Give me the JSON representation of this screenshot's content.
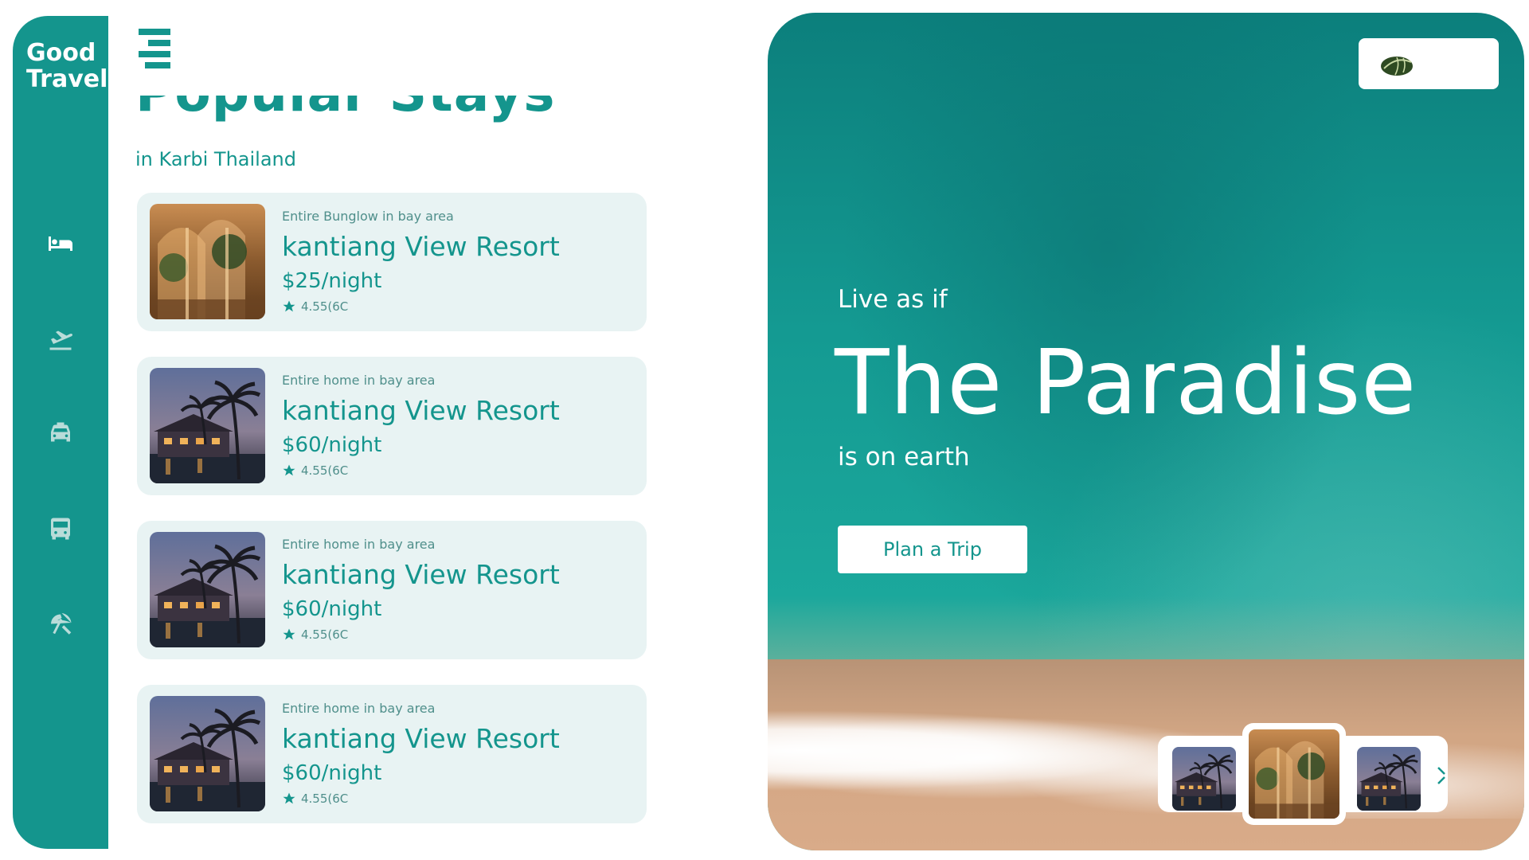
{
  "brand": {
    "line1": "Good",
    "line2": "Travel"
  },
  "sidebar": {
    "items": [
      {
        "icon": "bed-icon",
        "active": true
      },
      {
        "icon": "flight-icon",
        "active": false
      },
      {
        "icon": "taxi-icon",
        "active": false
      },
      {
        "icon": "bus-icon",
        "active": false
      },
      {
        "icon": "beach-umbrella-icon",
        "active": false
      }
    ]
  },
  "header": {
    "menu_icon": "hamburger-menu-icon"
  },
  "section": {
    "title": "Popular Stays",
    "subtitle": "in Karbi Thailand"
  },
  "stays": [
    {
      "kind": "Entire Bunglow in bay area",
      "name": "kantiang View Resort",
      "price": "$25/night",
      "rating": "4.55(6C",
      "image": "palace-hall"
    },
    {
      "kind": "Entire home in bay area",
      "name": "kantiang View Resort",
      "price": "$60/night",
      "rating": "4.55(6C",
      "image": "palm-resort-dusk"
    },
    {
      "kind": "Entire home in bay area",
      "name": "kantiang View Resort",
      "price": "$60/night",
      "rating": "4.55(6C",
      "image": "palm-resort-dusk"
    },
    {
      "kind": "Entire home in bay area",
      "name": "kantiang View Resort",
      "price": "$60/night",
      "rating": "4.55(6C",
      "image": "palm-resort-dusk"
    }
  ],
  "hero": {
    "line1": "Live as if",
    "headline": "The Paradise",
    "line3": "is on earth",
    "cta_label": "Plan a Trip",
    "profile_icon": "leaf-avatar-icon",
    "carousel": {
      "items": [
        "palm-resort-dusk",
        "palace-hall",
        "palm-resort-dusk"
      ],
      "active_index": 1,
      "next_icon": "chevron-right-icon"
    }
  },
  "colors": {
    "accent": "#14958d",
    "card_bg": "#e8f3f3",
    "white": "#ffffff"
  }
}
